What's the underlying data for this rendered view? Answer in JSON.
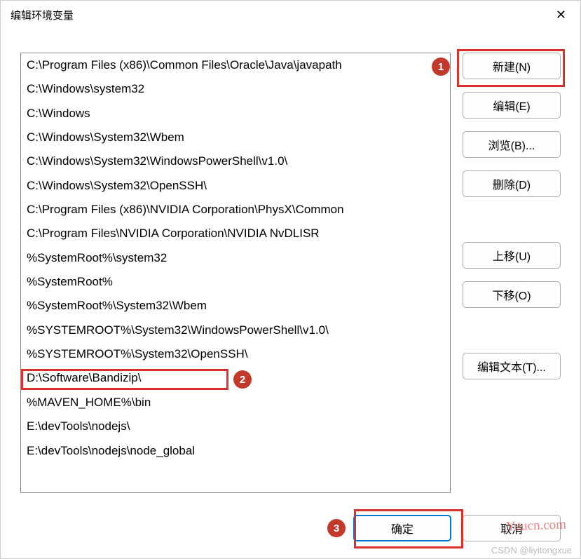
{
  "window": {
    "title": "编辑环境变量"
  },
  "list": {
    "items": [
      "C:\\Program Files (x86)\\Common Files\\Oracle\\Java\\javapath",
      "C:\\Windows\\system32",
      "C:\\Windows",
      "C:\\Windows\\System32\\Wbem",
      "C:\\Windows\\System32\\WindowsPowerShell\\v1.0\\",
      "C:\\Windows\\System32\\OpenSSH\\",
      "C:\\Program Files (x86)\\NVIDIA Corporation\\PhysX\\Common",
      "C:\\Program Files\\NVIDIA Corporation\\NVIDIA NvDLISR",
      "%SystemRoot%\\system32",
      "%SystemRoot%",
      "%SystemRoot%\\System32\\Wbem",
      "%SYSTEMROOT%\\System32\\WindowsPowerShell\\v1.0\\",
      "%SYSTEMROOT%\\System32\\OpenSSH\\",
      "D:\\Software\\Bandizip\\",
      "%MAVEN_HOME%\\bin",
      "E:\\devTools\\nodejs\\",
      "E:\\devTools\\nodejs\\node_global"
    ]
  },
  "buttons": {
    "new": "新建(N)",
    "edit": "编辑(E)",
    "browse": "浏览(B)...",
    "delete": "删除(D)",
    "moveup": "上移(U)",
    "movedown": "下移(O)",
    "edittext": "编辑文本(T)...",
    "ok": "确定",
    "cancel": "取消"
  },
  "badges": {
    "b1": "1",
    "b2": "2",
    "b3": "3"
  },
  "watermark": {
    "site": "Yuucn.com",
    "credit": "CSDN @liyitongxue"
  }
}
